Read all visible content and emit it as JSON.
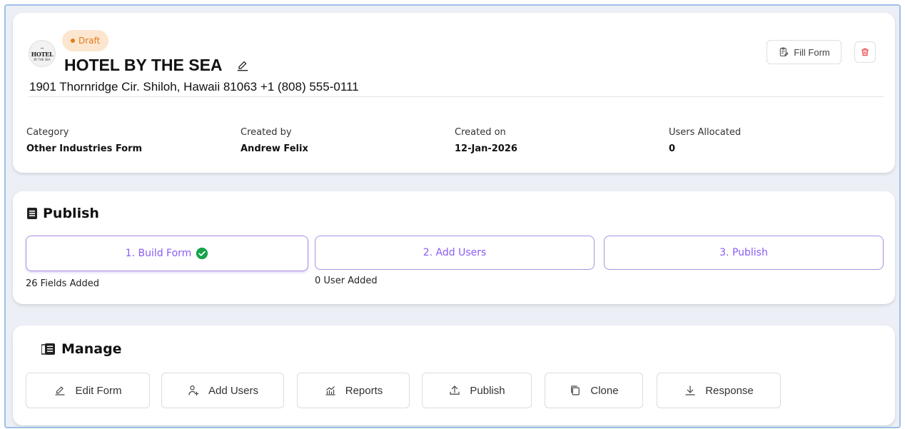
{
  "header": {
    "logo": {
      "top": "~",
      "main": "HOTEL",
      "sub": "BY THE SEA"
    },
    "status_badge": "Draft",
    "title": "HOTEL BY THE SEA",
    "address": "1901 Thornridge Cir. Shiloh, Hawaii 81063 +1 (808) 555-0111",
    "fill_form_label": "Fill Form",
    "meta": [
      {
        "label": "Category",
        "value": "Other Industries Form"
      },
      {
        "label": "Created by",
        "value": "Andrew Felix"
      },
      {
        "label": "Created on",
        "value": "12-Jan-2026"
      },
      {
        "label": "Users Allocated",
        "value": "0"
      }
    ]
  },
  "publish": {
    "title": "Publish",
    "steps": [
      {
        "label": "1. Build Form",
        "note": "26 Fields Added",
        "completed": true
      },
      {
        "label": "2. Add Users",
        "note": "0 User Added",
        "completed": false
      },
      {
        "label": "3. Publish",
        "note": "",
        "completed": false
      }
    ]
  },
  "manage": {
    "title": "Manage",
    "actions": [
      {
        "label": "Edit Form",
        "icon": "pencil-icon"
      },
      {
        "label": "Add Users",
        "icon": "add-user-icon"
      },
      {
        "label": "Reports",
        "icon": "chart-icon"
      },
      {
        "label": "Publish",
        "icon": "upload-icon"
      },
      {
        "label": "Clone",
        "icon": "copy-icon"
      },
      {
        "label": "Response",
        "icon": "download-icon"
      }
    ]
  },
  "colors": {
    "accent": "#8b5cf6",
    "draft_bg": "#fde6cf",
    "draft_text": "#e07b1b",
    "success": "#16a34a",
    "danger": "#ef4444"
  }
}
